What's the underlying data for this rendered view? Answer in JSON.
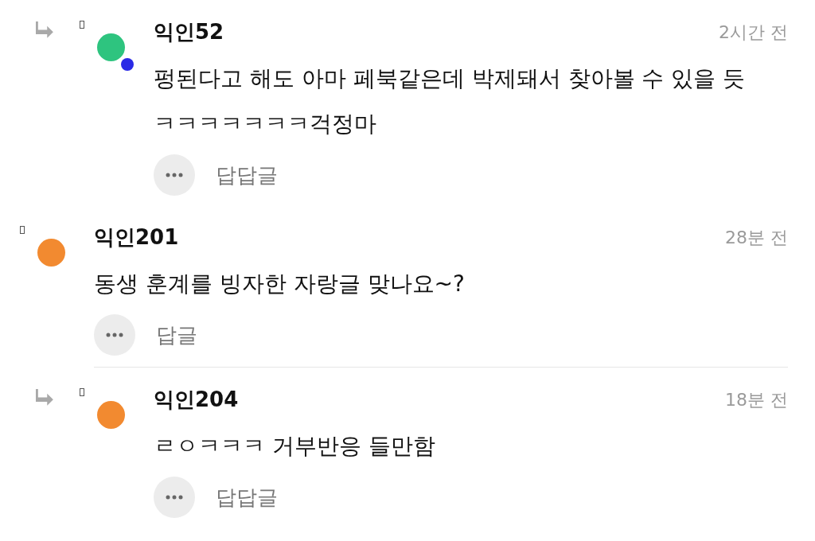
{
  "comments": [
    {
      "kind": "reply",
      "author": "익인52",
      "time": "2시간 전",
      "color": "#2ec47f",
      "badge": true,
      "text": "펑된다고 해도 아마 페북같은데 박제돼서 찾아볼 수 있을 듯ㅋㅋㅋㅋㅋㅋㅋ걱정마",
      "action": "답답글",
      "divider_after": false
    },
    {
      "kind": "comment",
      "author": "익인201",
      "time": "28분 전",
      "color": "#f28a30",
      "badge": false,
      "text": "동생 훈계를 빙자한 자랑글 맞나요~?",
      "action": "답글",
      "divider_after": true
    },
    {
      "kind": "reply",
      "author": "익인204",
      "time": "18분 전",
      "color": "#f28a30",
      "badge": false,
      "text": "ㄹㅇㅋㅋㅋ 거부반응 들만함",
      "action": "답답글",
      "divider_after": false
    }
  ]
}
